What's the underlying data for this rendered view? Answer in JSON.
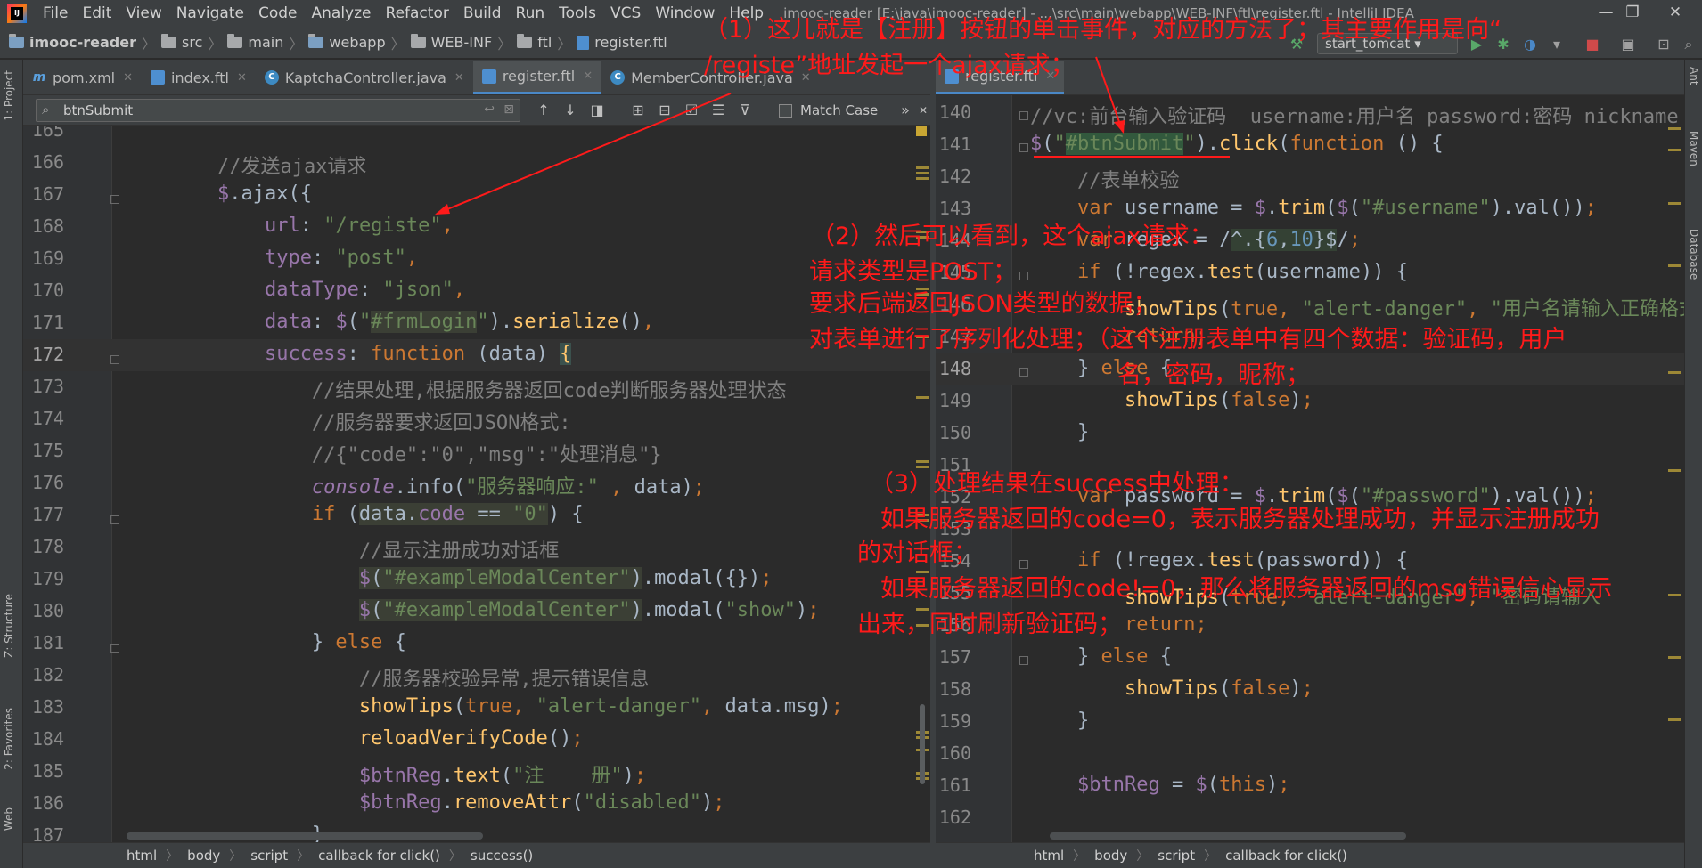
{
  "window": {
    "title": "imooc-reader [E:\\java\\imooc-reader] - ...\\src\\main\\webapp\\WEB-INF\\ftl\\register.ftl - IntelliJ IDEA",
    "menu": [
      "File",
      "Edit",
      "View",
      "Navigate",
      "Code",
      "Analyze",
      "Refactor",
      "Build",
      "Run",
      "Tools",
      "VCS",
      "Window",
      "Help"
    ],
    "controls": {
      "minimize": "—",
      "restore": "❐",
      "close": "✕"
    }
  },
  "navbar": {
    "crumbs": [
      "imooc-reader",
      "src",
      "main",
      "webapp",
      "WEB-INF",
      "ftl",
      "register.ftl"
    ],
    "run_config": "start_tomcat"
  },
  "left_tabs": {
    "project": "1: Project",
    "structure": "Z: Structure",
    "favorites": "2: Favorites",
    "web": "Web"
  },
  "right_tabs": {
    "ant": "Ant",
    "maven": "Maven",
    "database": "Database"
  },
  "left_pane": {
    "tabs": [
      "pom.xml",
      "index.ftl",
      "KaptchaController.java",
      "register.ftl",
      "MemberController.java"
    ],
    "active_tab": "register.ftl",
    "search": {
      "value": "btnSubmit",
      "match_case": "Match Case"
    },
    "footer": [
      "html",
      "body",
      "script",
      "callback for click()",
      "success()"
    ]
  },
  "right_pane": {
    "tab": "register.ftl",
    "footer": [
      "html",
      "body",
      "script",
      "callback for click()"
    ]
  },
  "annotations": {
    "a1_line1": "（1）这儿就是【注册】按钮的单击事件，对应的方法了；其主要作用是向“",
    "a1_line2": "/registe”地址发起一个ajax请求；",
    "a2_line1": "（2）然后可以看到，这个ajax请求：",
    "a2_line2": "请求类型是POST；",
    "a2_line3": "要求后端返回JSON类型的数据；",
    "a2_line4": "对表单进行了序列化处理；（这个注册表单中有四个数据：验证码，用户",
    "a2_line5": "名，密码，昵称；",
    "a3_line1": "（3）处理结果在success中处理：",
    "a3_line2": "如果服务器返回的code=0，表示服务器处理成功，并显示注册成功",
    "a3_line3": "的对话框；",
    "a3_line4": "如果服务器返回的code!=0，那么将服务器返回的msg错误信心显示",
    "a3_line5": "出来，同时刷新验证码；"
  }
}
